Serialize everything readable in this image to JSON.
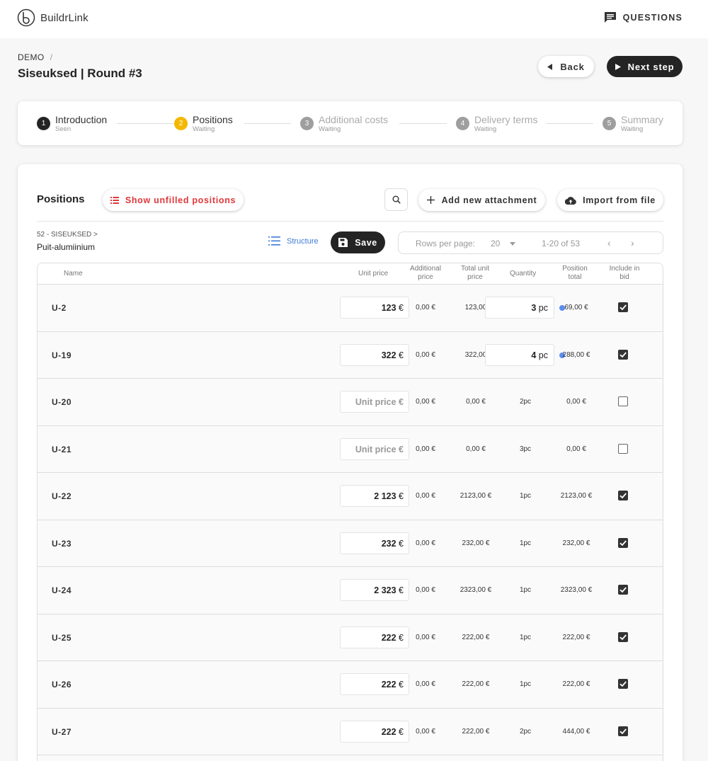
{
  "app": {
    "name": "BuildrLink",
    "questions_label": "QUESTIONS"
  },
  "header": {
    "breadcrumb": "DEMO",
    "breadcrumb_sep": "/",
    "title": "Siseuksed | Round #3",
    "back_label": "Back",
    "next_label": "Next step"
  },
  "steps": [
    {
      "num": "1",
      "label": "Introduction",
      "status": "Seen",
      "state": "done"
    },
    {
      "num": "2",
      "label": "Positions",
      "status": "Waiting",
      "state": "active"
    },
    {
      "num": "3",
      "label": "Additional costs",
      "status": "Waiting",
      "state": "todo"
    },
    {
      "num": "4",
      "label": "Delivery terms",
      "status": "Waiting",
      "state": "todo"
    },
    {
      "num": "5",
      "label": "Summary",
      "status": "Waiting",
      "state": "todo"
    }
  ],
  "positions": {
    "title": "Positions",
    "unfilled_label": "Show unfilled positions",
    "add_attachment_label": "Add new attachment",
    "import_label": "Import from file",
    "path_top": "52 - SISEUKSED >",
    "path_bottom": "Puit-alumiinium",
    "structure_label": "Structure",
    "save_label": "Save",
    "pager": {
      "rows_label": "Rows per page:",
      "rows_value": "20",
      "range": "1-20 of 53",
      "prev": "‹",
      "next": "›"
    }
  },
  "table": {
    "columns": {
      "name": "Name",
      "unit_price": "Unit price",
      "additional_price": [
        "Additional",
        "price"
      ],
      "total_unit_price": [
        "Total unit",
        "price"
      ],
      "quantity": "Quantity",
      "position_total": [
        "Position",
        "total"
      ],
      "include_in_bid": [
        "Include in",
        "bid"
      ]
    },
    "rows": [
      {
        "name": "U-2",
        "unit_price": "123",
        "unit_price_placeholder": "",
        "additional": "0,00 €",
        "total_unit": "123,00",
        "qty_value": "3",
        "qty_unit": "pc",
        "qty_text": "",
        "position_total": "69,00 €",
        "dot": true,
        "included": true
      },
      {
        "name": "U-19",
        "unit_price": "322",
        "unit_price_placeholder": "",
        "additional": "0,00 €",
        "total_unit": "322,00",
        "qty_value": "4",
        "qty_unit": "pc",
        "qty_text": "",
        "position_total": "288,00 €",
        "dot": true,
        "included": true
      },
      {
        "name": "U-20",
        "unit_price": "",
        "unit_price_placeholder": "Unit price",
        "additional": "0,00 €",
        "total_unit": "0,00 €",
        "qty_value": "",
        "qty_unit": "",
        "qty_text": "2pc",
        "position_total": "0,00 €",
        "dot": false,
        "included": false
      },
      {
        "name": "U-21",
        "unit_price": "",
        "unit_price_placeholder": "Unit price",
        "additional": "0,00 €",
        "total_unit": "0,00 €",
        "qty_value": "",
        "qty_unit": "",
        "qty_text": "3pc",
        "position_total": "0,00 €",
        "dot": false,
        "included": false
      },
      {
        "name": "U-22",
        "unit_price": "2 123",
        "unit_price_placeholder": "",
        "additional": "0,00 €",
        "total_unit": "2123,00 €",
        "qty_value": "",
        "qty_unit": "",
        "qty_text": "1pc",
        "position_total": "2123,00 €",
        "dot": false,
        "included": true
      },
      {
        "name": "U-23",
        "unit_price": "232",
        "unit_price_placeholder": "",
        "additional": "0,00 €",
        "total_unit": "232,00 €",
        "qty_value": "",
        "qty_unit": "",
        "qty_text": "1pc",
        "position_total": "232,00 €",
        "dot": false,
        "included": true
      },
      {
        "name": "U-24",
        "unit_price": "2 323",
        "unit_price_placeholder": "",
        "additional": "0,00 €",
        "total_unit": "2323,00 €",
        "qty_value": "",
        "qty_unit": "",
        "qty_text": "1pc",
        "position_total": "2323,00 €",
        "dot": false,
        "included": true
      },
      {
        "name": "U-25",
        "unit_price": "222",
        "unit_price_placeholder": "",
        "additional": "0,00 €",
        "total_unit": "222,00 €",
        "qty_value": "",
        "qty_unit": "",
        "qty_text": "1pc",
        "position_total": "222,00 €",
        "dot": false,
        "included": true
      },
      {
        "name": "U-26",
        "unit_price": "222",
        "unit_price_placeholder": "",
        "additional": "0,00 €",
        "total_unit": "222,00 €",
        "qty_value": "",
        "qty_unit": "",
        "qty_text": "1pc",
        "position_total": "222,00 €",
        "dot": false,
        "included": true
      },
      {
        "name": "U-27",
        "unit_price": "222",
        "unit_price_placeholder": "",
        "additional": "0,00 €",
        "total_unit": "222,00 €",
        "qty_value": "",
        "qty_unit": "",
        "qty_text": "2pc",
        "position_total": "444,00 €",
        "dot": false,
        "included": true
      }
    ],
    "currency_symbol": "€"
  },
  "colors": {
    "accent_dark": "#242424",
    "active_step": "#f5b800",
    "link_blue": "#3f7bd8",
    "danger_red": "#e0373a"
  }
}
